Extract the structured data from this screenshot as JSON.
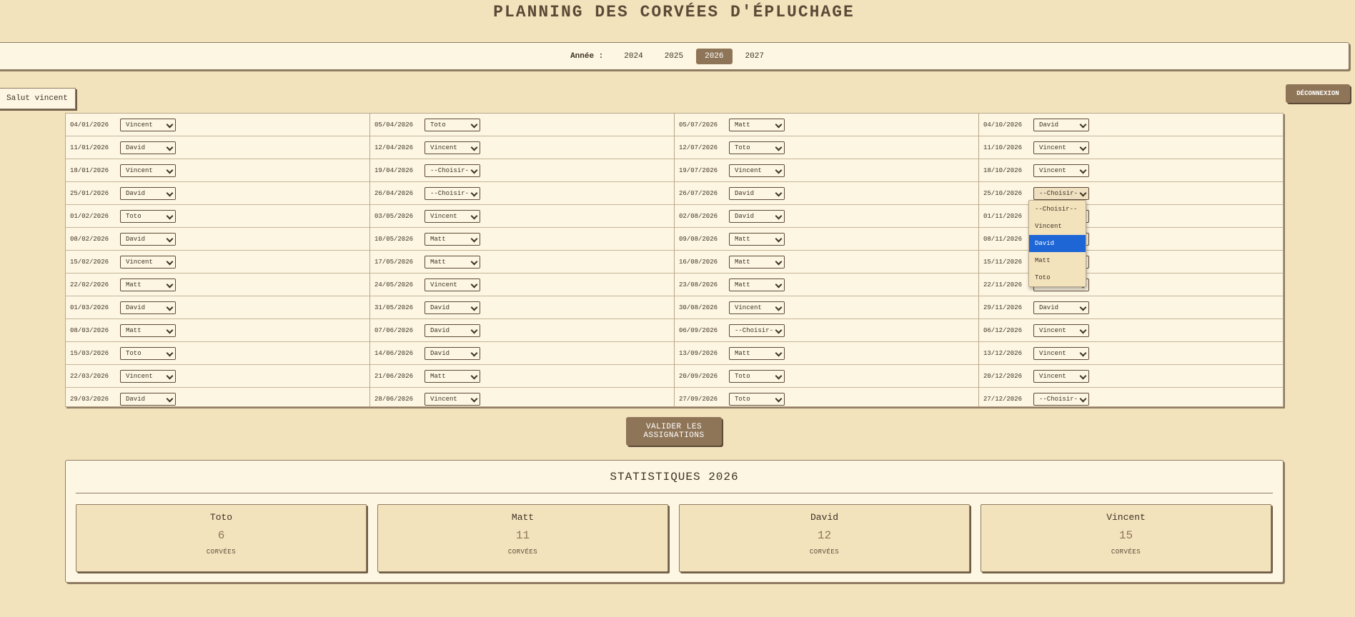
{
  "header": {
    "title": "PLANNING DES CORVÉES D'ÉPLUCHAGE"
  },
  "years": {
    "label": "Année :",
    "items": [
      "2024",
      "2025",
      "2026",
      "2027"
    ],
    "active": "2026"
  },
  "user": {
    "greeting": "Salut vincent",
    "logout": "DÉCONNEXION"
  },
  "schedule": {
    "columns": [
      [
        {
          "date": "04/01/2026",
          "value": "Vincent"
        },
        {
          "date": "11/01/2026",
          "value": "David"
        },
        {
          "date": "18/01/2026",
          "value": "Vincent"
        },
        {
          "date": "25/01/2026",
          "value": "David"
        },
        {
          "date": "01/02/2026",
          "value": "Toto"
        },
        {
          "date": "08/02/2026",
          "value": "David"
        },
        {
          "date": "15/02/2026",
          "value": "Vincent"
        },
        {
          "date": "22/02/2026",
          "value": "Matt"
        },
        {
          "date": "01/03/2026",
          "value": "David"
        },
        {
          "date": "08/03/2026",
          "value": "Matt"
        },
        {
          "date": "15/03/2026",
          "value": "Toto"
        },
        {
          "date": "22/03/2026",
          "value": "Vincent"
        },
        {
          "date": "29/03/2026",
          "value": "David"
        }
      ],
      [
        {
          "date": "05/04/2026",
          "value": "Toto"
        },
        {
          "date": "12/04/2026",
          "value": "Vincent"
        },
        {
          "date": "19/04/2026",
          "value": "--Choisir--"
        },
        {
          "date": "26/04/2026",
          "value": "--Choisir--"
        },
        {
          "date": "03/05/2026",
          "value": "Vincent"
        },
        {
          "date": "10/05/2026",
          "value": "Matt"
        },
        {
          "date": "17/05/2026",
          "value": "Matt"
        },
        {
          "date": "24/05/2026",
          "value": "Vincent"
        },
        {
          "date": "31/05/2026",
          "value": "David"
        },
        {
          "date": "07/06/2026",
          "value": "David"
        },
        {
          "date": "14/06/2026",
          "value": "David"
        },
        {
          "date": "21/06/2026",
          "value": "Matt"
        },
        {
          "date": "28/06/2026",
          "value": "Vincent"
        }
      ],
      [
        {
          "date": "05/07/2026",
          "value": "Matt"
        },
        {
          "date": "12/07/2026",
          "value": "Toto"
        },
        {
          "date": "19/07/2026",
          "value": "Vincent"
        },
        {
          "date": "26/07/2026",
          "value": "David"
        },
        {
          "date": "02/08/2026",
          "value": "David"
        },
        {
          "date": "09/08/2026",
          "value": "Matt"
        },
        {
          "date": "16/08/2026",
          "value": "Matt"
        },
        {
          "date": "23/08/2026",
          "value": "Matt"
        },
        {
          "date": "30/08/2026",
          "value": "Vincent"
        },
        {
          "date": "06/09/2026",
          "value": "--Choisir--"
        },
        {
          "date": "13/09/2026",
          "value": "Matt"
        },
        {
          "date": "20/09/2026",
          "value": "Toto"
        },
        {
          "date": "27/09/2026",
          "value": "Toto"
        }
      ],
      [
        {
          "date": "04/10/2026",
          "value": "David"
        },
        {
          "date": "11/10/2026",
          "value": "Vincent"
        },
        {
          "date": "18/10/2026",
          "value": "Vincent"
        },
        {
          "date": "25/10/2026",
          "value": "--Choisir--",
          "open": true
        },
        {
          "date": "01/11/2026",
          "value": ""
        },
        {
          "date": "08/11/2026",
          "value": ""
        },
        {
          "date": "15/11/2026",
          "value": ""
        },
        {
          "date": "22/11/2026",
          "value": ""
        },
        {
          "date": "29/11/2026",
          "value": "David"
        },
        {
          "date": "06/12/2026",
          "value": "Vincent"
        },
        {
          "date": "13/12/2026",
          "value": "Vincent"
        },
        {
          "date": "20/12/2026",
          "value": "Vincent"
        },
        {
          "date": "27/12/2026",
          "value": "--Choisir--"
        }
      ]
    ]
  },
  "dropdown": {
    "options": [
      "--Choisir--",
      "Vincent",
      "David",
      "Matt",
      "Toto"
    ],
    "highlighted": "David",
    "highlight_color": "#1e66d6"
  },
  "actions": {
    "validate": "VALIDER LES ASSIGNATIONS"
  },
  "stats": {
    "title": "STATISTIQUES 2026",
    "cards": [
      {
        "name": "Toto",
        "count": "6",
        "unit": "CORVÉES"
      },
      {
        "name": "Matt",
        "count": "11",
        "unit": "CORVÉES"
      },
      {
        "name": "David",
        "count": "12",
        "unit": "CORVÉES"
      },
      {
        "name": "Vincent",
        "count": "15",
        "unit": "CORVÉES"
      }
    ]
  },
  "colors": {
    "background": "#f3e3bd",
    "panel": "#fdf6e3",
    "accent": "#8f7558"
  }
}
